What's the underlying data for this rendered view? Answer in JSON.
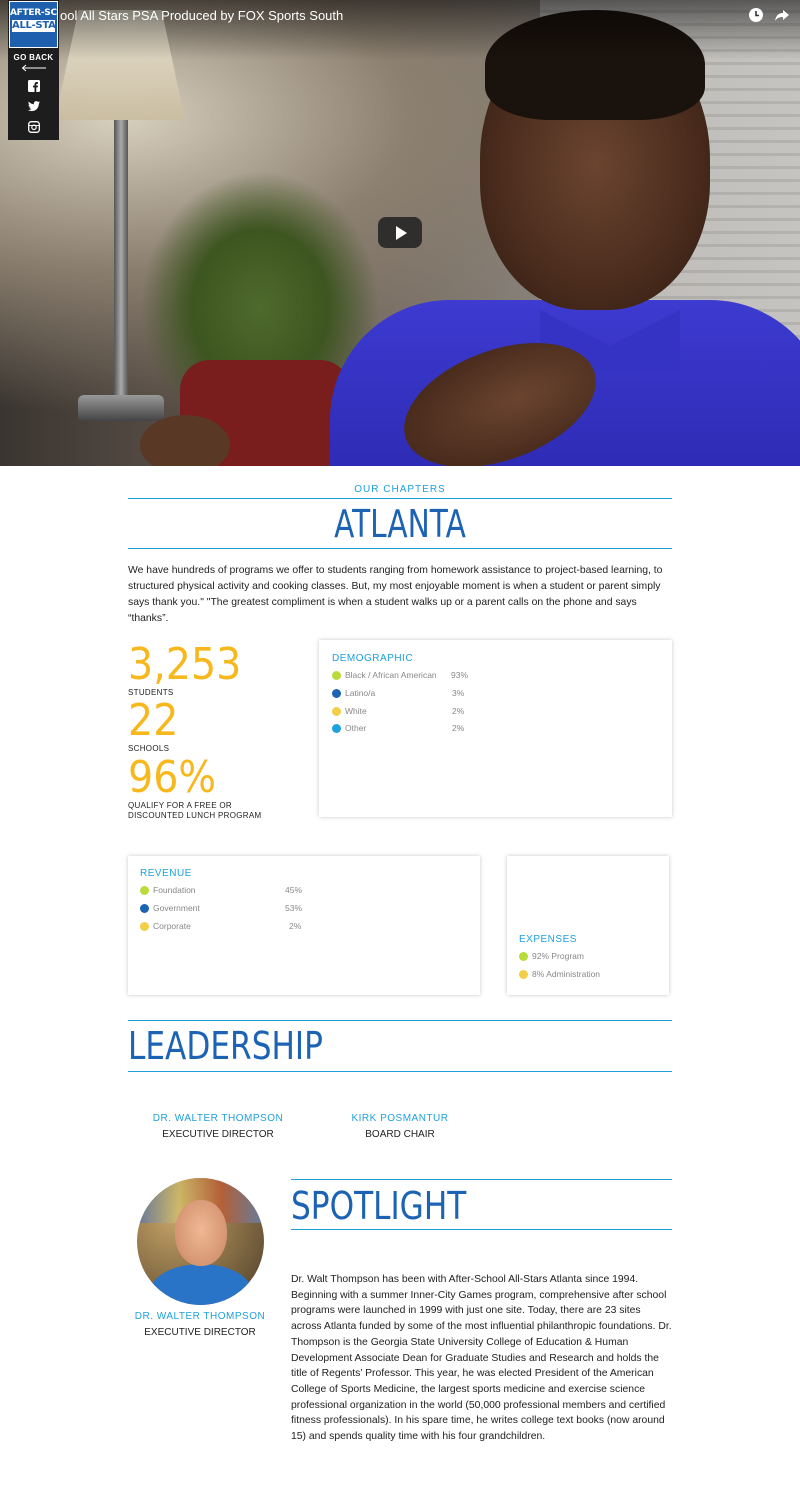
{
  "video": {
    "title": "ool All Stars PSA Produced by FOX Sports South",
    "icons": [
      "clock-icon",
      "share-icon"
    ],
    "play_icon": "play-icon"
  },
  "side_nav": {
    "logo_lines": [
      "AFTER-SCHOOL",
      "ALL-STARS"
    ],
    "go_back": "GO BACK",
    "social": [
      "facebook-icon",
      "twitter-icon",
      "instagram-icon"
    ]
  },
  "chapter": {
    "eyebrow": "OUR CHAPTERS",
    "city": "ATLANTA",
    "intro": "We have hundreds of programs we offer to students ranging from homework assistance to project-based learning, to structured physical activity and cooking classes. But, my most enjoyable moment is when a student or parent simply says thank you.\" \"The greatest compliment is when a student walks up or a parent calls on the phone and says “thanks”."
  },
  "stats": [
    {
      "value": "3,253",
      "label": "STUDENTS"
    },
    {
      "value": "22",
      "label": "SCHOOLS"
    },
    {
      "value": "96%",
      "label": "QUALIFY FOR A FREE OR DISCOUNTED LUNCH PROGRAM"
    }
  ],
  "demographic": {
    "title": "DEMOGRAPHIC",
    "items": [
      {
        "label": "Black / African American",
        "pct": "93%",
        "color": "#b9dc3a"
      },
      {
        "label": "Latino/a",
        "pct": "3%",
        "color": "#1c63b4"
      },
      {
        "label": "White",
        "pct": "2%",
        "color": "#f3cf45"
      },
      {
        "label": "Other",
        "pct": "2%",
        "color": "#1ea0dc"
      }
    ]
  },
  "revenue": {
    "title": "REVENUE",
    "items": [
      {
        "label": "Foundation",
        "pct": "45%",
        "color": "#b9dc3a"
      },
      {
        "label": "Government",
        "pct": "53%",
        "color": "#1c63b4"
      },
      {
        "label": "Corporate",
        "pct": "2%",
        "color": "#f3cf45"
      }
    ]
  },
  "expenses": {
    "title": "EXPENSES",
    "items": [
      {
        "label": "92% Program",
        "color": "#b9dc3a"
      },
      {
        "label": "8% Administration",
        "color": "#f3cf45"
      }
    ]
  },
  "leadership": {
    "title": "LEADERSHIP",
    "people": [
      {
        "name": "DR. WALTER THOMPSON",
        "role": "EXECUTIVE DIRECTOR"
      },
      {
        "name": "KIRK POSMANTUR",
        "role": "BOARD CHAIR"
      }
    ]
  },
  "spotlight": {
    "title": "SPOTLIGHT",
    "name": "DR. WALTER THOMPSON",
    "role": "EXECUTIVE DIRECTOR",
    "bio": "Dr. Walt Thompson has been with After-School All-Stars Atlanta since 1994. Beginning with a summer Inner-City Games program, comprehensive after school programs were launched in 1999 with just one site. Today, there are 23 sites across Atlanta funded by some of the most influential philanthropic foundations. Dr. Thompson is the Georgia State University College of Education & Human Development Associate Dean for Graduate Studies and Research and holds the title of Regents’ Professor. This year, he was elected President of the American College of Sports Medicine, the largest sports medicine and exercise science professional organization in the world (50,000 professional members and certified fitness professionals). In his spare time, he writes college text books (now around 15) and spends quality time with his four grandchildren."
  },
  "colors": {
    "accent": "#1ea0dc",
    "heading": "#1c63b4",
    "stat": "#f7b81e"
  }
}
